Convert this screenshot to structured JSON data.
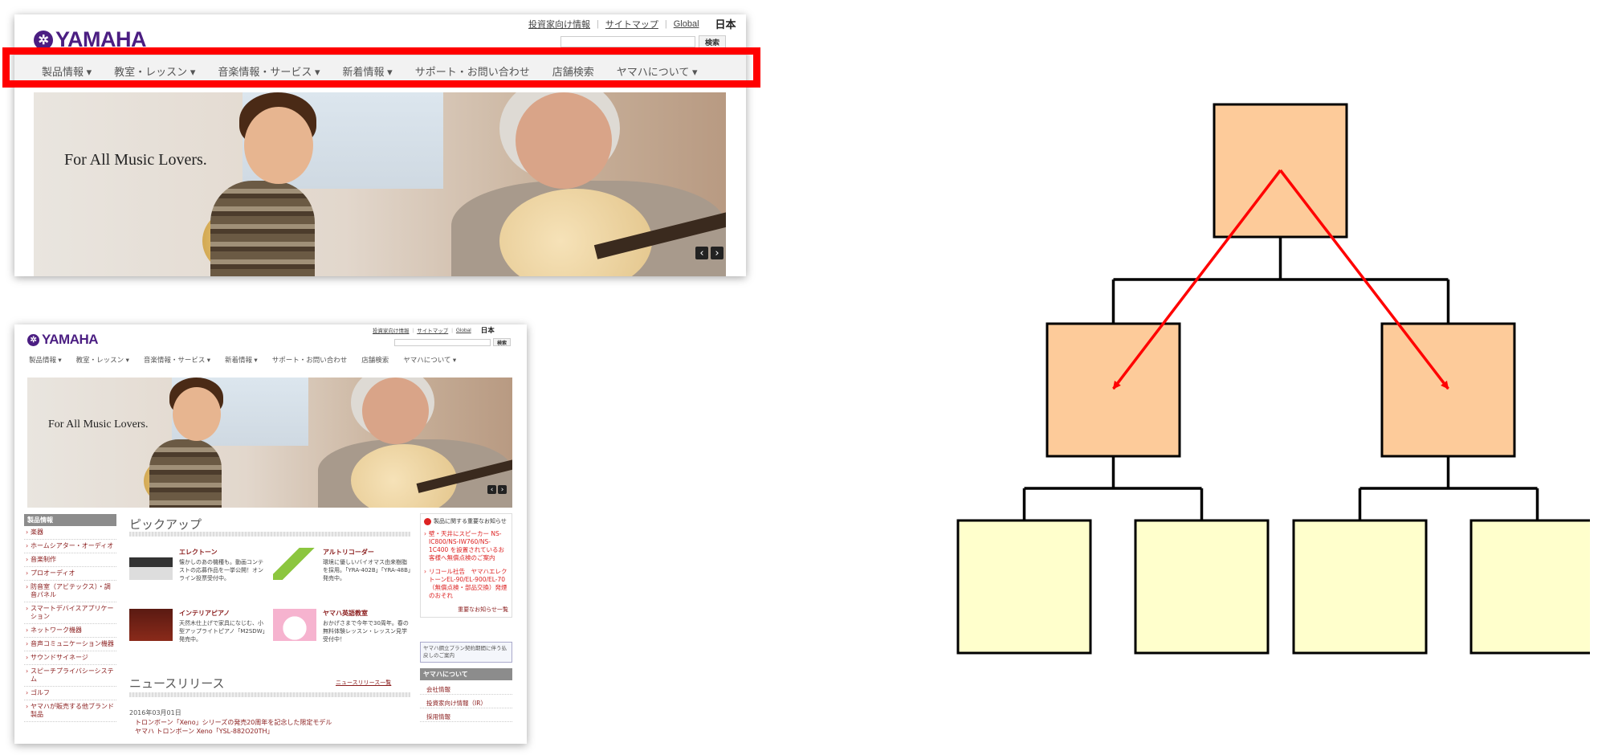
{
  "site": {
    "logo_text": "YAMAHA",
    "logo_mark": "✲",
    "utility_links": [
      "投資家向け情報",
      "サイトマップ",
      "Global"
    ],
    "language": "日本",
    "search_button": "検索",
    "search_placeholder": "",
    "nav_items": [
      {
        "label": "製品情報",
        "caret": "▾"
      },
      {
        "label": "教室・レッスン",
        "caret": "▾"
      },
      {
        "label": "音楽情報・サービス",
        "caret": "▾"
      },
      {
        "label": "新着情報",
        "caret": "▾"
      },
      {
        "label": "サポート・お問い合わせ",
        "caret": ""
      },
      {
        "label": "店舗検索",
        "caret": ""
      },
      {
        "label": "ヤマハについて",
        "caret": "▾"
      }
    ],
    "hero_tagline": "For All Music Lovers.",
    "hero_prev": "‹",
    "hero_next": "›"
  },
  "lower_page": {
    "sidebar_title": "製品情報",
    "sidebar_items": [
      "楽器",
      "ホームシアター・オーディオ",
      "音楽制作",
      "プロオーディオ",
      "防音室（アビテックス）・調音パネル",
      "スマートデバイスアプリケーション",
      "ネットワーク機器",
      "音声コミュニケーション機器",
      "サウンドサイネージ",
      "スピーチプライバシーシステム",
      "ゴルフ",
      "ヤマハが販売する他ブランド製品"
    ],
    "pickup_title": "ピックアップ",
    "pickups": [
      {
        "title": "エレクトーン",
        "desc": "懐かしのあの機種も。動画コンテストの応募作品を一挙公開！オンライン投票受付中。"
      },
      {
        "title": "アルトリコーダー",
        "desc": "環境に優しいバイオマス由来樹脂を採用。「YRA-402B」「YRA-48B」発売中。"
      },
      {
        "title": "インテリアピアノ",
        "desc": "天然木仕上げで家具になじむ、小型アップライトピアノ「M2SDW」発売中。"
      },
      {
        "title": "ヤマハ英語教室",
        "desc": "おかげさまで今年で30周年。春の無料体験レッスン・レッスン見学受付中！"
      }
    ],
    "notice_header": "製品に関する重要なお知らせ",
    "notices": [
      "壁・天井にスピーカー NS-IC800/NS-IW760/NS-1C400 を設置されているお客様へ無償点検のご案内",
      "リコール社告　ヤマハエレクトーンEL-90/EL-900/EL-70（無償点検・部品交換）発煙のおそれ"
    ],
    "notice_more": "重要なお知らせ一覧",
    "side_box_text": "ヤマハ鋼立プラン契約期間に伴う払戻しのご案内",
    "about_title": "ヤマハについて",
    "about_items": [
      "会社情報",
      "投資家向け情報（IR）",
      "採用情報"
    ],
    "news_title": "ニュースリリース",
    "news_more": "ニュースリリース一覧",
    "news_date": "2016年03月01日",
    "news_items": [
      "トロンボーン「Xeno」シリーズの発売20周年を記念した限定モデル",
      "ヤマハ トロンボーン Xeno「YSL-882O20TH」"
    ]
  },
  "diagram": {
    "node_colors": {
      "root": "#fdcb9a",
      "middle": "#fdcb9a",
      "leaf": "#ffffcc"
    },
    "arrow_color": "#ff0000",
    "frame_color": "#ff0000",
    "tree": {
      "root": 1,
      "middle": 2,
      "leaves_per_middle": 2
    }
  }
}
